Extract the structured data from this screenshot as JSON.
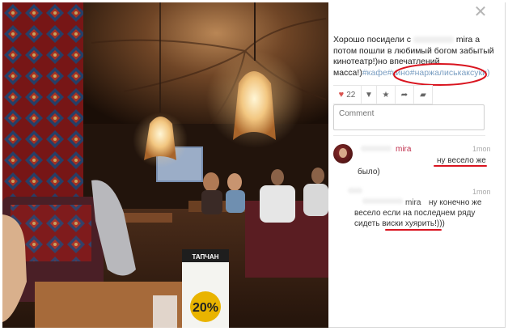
{
  "post": {
    "caption_prefix": "Хорошо посидели с",
    "caption_user": "mira",
    "caption_body": "а потом пошли в любимый богом забытый кинотеатр!)но впечатлений масса!)",
    "caption_tags": "#кафе#кино#наржалиськаксуки)",
    "likes_count": "22",
    "comment_placeholder": "Comment"
  },
  "comments": [
    {
      "user": "mira",
      "time": "1mon",
      "text_part1": "ну весело же",
      "text_part2": "было)"
    },
    {
      "user": "mira",
      "time": "1mon",
      "text": "ну конечно же весело если на последнем ряду сидеть виски хуярить!)))"
    }
  ],
  "photo": {
    "sign_brand": "ТАПЧАН",
    "sign_percent": "20%"
  },
  "icons": {
    "close": "close-icon",
    "like": "heart-icon",
    "more": "chevron-down-icon",
    "favorite": "star-icon",
    "share": "share-arrow-icon",
    "reply": "speech-bubble-icon"
  },
  "colors": {
    "annotation_red": "#d9141f",
    "tag_blue": "#7a9ec2",
    "like_red": "#d9534f",
    "username": "#c0304d"
  }
}
